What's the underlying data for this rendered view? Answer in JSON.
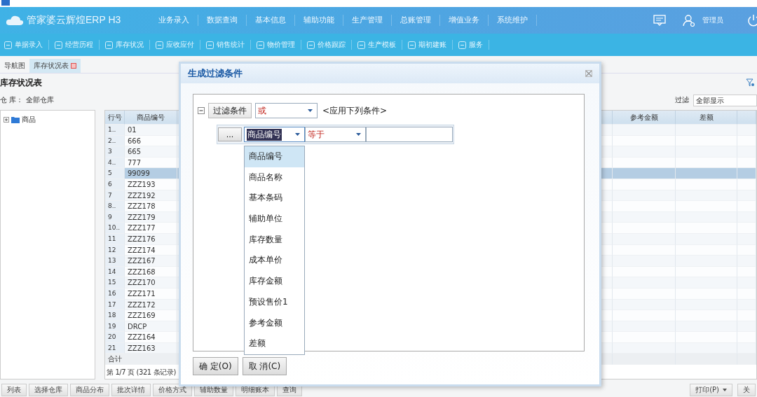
{
  "nav": {
    "app_name": "管家婆云辉煌ERP H3",
    "menu": [
      {
        "label": "业务录入"
      },
      {
        "label": "数据查询"
      },
      {
        "label": "基本信息"
      },
      {
        "label": "辅助功能"
      },
      {
        "label": "生产管理"
      },
      {
        "label": "总账管理"
      },
      {
        "label": "增值业务"
      },
      {
        "label": "系统维护"
      }
    ],
    "user": "管理员"
  },
  "toolbar": [
    {
      "label": "单据录入"
    },
    {
      "label": "经营历程"
    },
    {
      "label": "库存状况"
    },
    {
      "label": "应收应付"
    },
    {
      "label": "销售统计"
    },
    {
      "label": "物价管理"
    },
    {
      "label": "价格跟踪"
    },
    {
      "label": "生产模板"
    },
    {
      "label": "期初建账"
    },
    {
      "label": "服务"
    }
  ],
  "tabs": [
    {
      "label": "导航图",
      "selected": false,
      "closable": false
    },
    {
      "label": "库存状况表",
      "selected": true,
      "closable": true
    }
  ],
  "report": {
    "title": "库存状况表",
    "warehouse_label": "仓 库：",
    "warehouse": "全部仓库",
    "filter_label": "过滤",
    "filter_value": "全部显示"
  },
  "tree": [
    {
      "label": "商品",
      "expanded": false
    }
  ],
  "table": {
    "columns": [
      "行号",
      "商品编号",
      "参考金额",
      "差额"
    ],
    "rows": [
      {
        "no": "1..",
        "code": "01",
        "selected": false
      },
      {
        "no": "2..",
        "code": "666",
        "selected": false
      },
      {
        "no": "3",
        "code": "665",
        "selected": false
      },
      {
        "no": "4..",
        "code": "777",
        "selected": false
      },
      {
        "no": "5",
        "code": "99099",
        "selected": true
      },
      {
        "no": "6",
        "code": "ZZZ193",
        "selected": false
      },
      {
        "no": "7",
        "code": "ZZZ192",
        "selected": false
      },
      {
        "no": "8..",
        "code": "ZZZ178",
        "selected": false
      },
      {
        "no": "9",
        "code": "ZZZ179",
        "selected": false
      },
      {
        "no": "10..",
        "code": "ZZZ177",
        "selected": false
      },
      {
        "no": "11",
        "code": "ZZZ176",
        "selected": false
      },
      {
        "no": "12",
        "code": "ZZZ174",
        "selected": false
      },
      {
        "no": "13",
        "code": "ZZZ167",
        "selected": false
      },
      {
        "no": "14",
        "code": "ZZZ168",
        "selected": false
      },
      {
        "no": "15",
        "code": "ZZZ170",
        "selected": false
      },
      {
        "no": "16",
        "code": "ZZZ171",
        "selected": false
      },
      {
        "no": "17",
        "code": "ZZZ172",
        "selected": false
      },
      {
        "no": "18",
        "code": "ZZZ169",
        "selected": false
      },
      {
        "no": "19",
        "code": "DRCP",
        "selected": false
      },
      {
        "no": "20",
        "code": "ZZZ164",
        "selected": false
      },
      {
        "no": "21",
        "code": "ZZZ163",
        "selected": false
      }
    ],
    "total_label": "合计",
    "pager": "第 1/7 页 (321 条记录)"
  },
  "bottom_buttons": [
    "列表",
    "选择仓库",
    "商品分布",
    "批次详情",
    "价格方式",
    "辅助数量",
    "明细账本",
    "查询"
  ],
  "bottom_right_buttons": [
    {
      "label": "打印(P)",
      "dropdown": true
    },
    {
      "label": "关",
      "dropdown": false
    }
  ],
  "dialog": {
    "title": "生成过滤条件",
    "root": {
      "label": "过滤条件",
      "expanded": true,
      "operator": "或",
      "hint": "<应用下列条件>"
    },
    "condition": {
      "more": "...",
      "field": "商品编号",
      "comparison": "等于"
    },
    "field_options": [
      {
        "label": "商品编号",
        "selected": true
      },
      {
        "label": "商品名称",
        "selected": false
      },
      {
        "label": "基本条码",
        "selected": false
      },
      {
        "label": "辅助单位",
        "selected": false
      },
      {
        "label": "库存数量",
        "selected": false
      },
      {
        "label": "成本单价",
        "selected": false
      },
      {
        "label": "库存金额",
        "selected": false
      },
      {
        "label": "预设售价1",
        "selected": false
      },
      {
        "label": "参考金额",
        "selected": false
      },
      {
        "label": "差额",
        "selected": false
      }
    ],
    "buttons": [
      "确 定(O)",
      "取 消(C)"
    ]
  }
}
